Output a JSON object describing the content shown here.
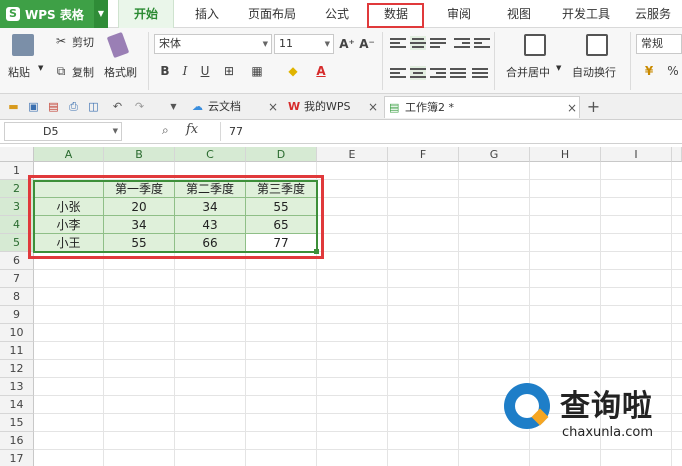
{
  "app": {
    "name": "WPS 表格",
    "logo_letter": "S"
  },
  "menu": {
    "tabs": [
      "开始",
      "插入",
      "页面布局",
      "公式",
      "数据",
      "审阅",
      "视图",
      "开发工具",
      "云服务"
    ],
    "active": "开始",
    "highlighted": "数据"
  },
  "ribbon": {
    "paste": "粘贴",
    "cut": "剪切",
    "copy": "复制",
    "format_painter": "格式刷",
    "font_name": "宋体",
    "font_size": "11",
    "grow_font": "A⁺",
    "shrink_font": "A⁻",
    "bold": "B",
    "italic": "I",
    "underline": "U",
    "font_color_glyph": "A",
    "merge_center": "合并居中",
    "wrap_text": "自动换行",
    "number_format": "常规",
    "currency": "¥",
    "percent": "%"
  },
  "doc_tabs": [
    {
      "label": "云文档"
    },
    {
      "label": "我的WPS"
    },
    {
      "label": "工作簿2 *"
    }
  ],
  "formula_bar": {
    "cell_ref": "D5",
    "fx": "fx",
    "value": "77"
  },
  "grid": {
    "columns": [
      "A",
      "B",
      "C",
      "D",
      "E",
      "F",
      "G",
      "H",
      "I"
    ],
    "rows": [
      "1",
      "2",
      "3",
      "4",
      "5",
      "6",
      "7",
      "8",
      "9",
      "10",
      "11",
      "12",
      "13",
      "14",
      "15",
      "16",
      "17"
    ],
    "table": {
      "header": [
        "",
        "第一季度",
        "第二季度",
        "第三季度"
      ],
      "data": [
        [
          "小张",
          "20",
          "34",
          "55"
        ],
        [
          "小李",
          "34",
          "43",
          "65"
        ],
        [
          "小王",
          "55",
          "66",
          "77"
        ]
      ]
    }
  },
  "watermark": {
    "title": "查询啦",
    "url": "chaxunla.com"
  },
  "colors": {
    "accent": "#3ea046",
    "highlight": "#e0393b",
    "selection_fill": "#dff0da"
  }
}
